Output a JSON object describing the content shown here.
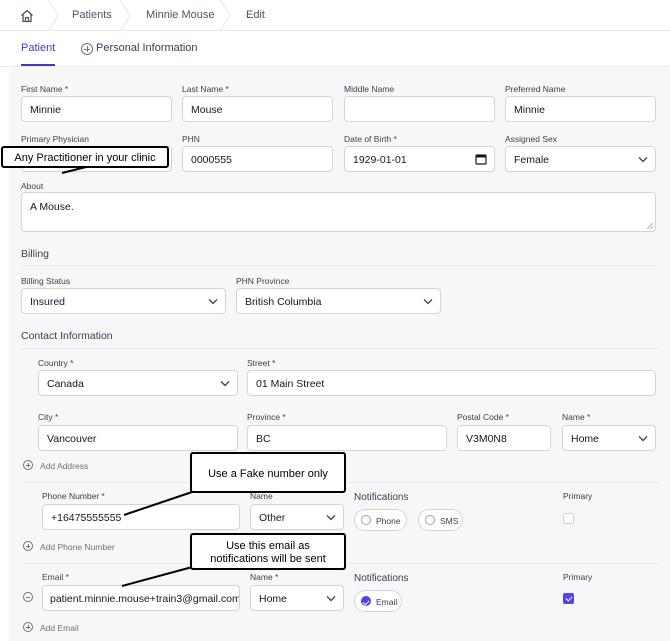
{
  "breadcrumb": {
    "items": [
      "Patients",
      "Minnie Mouse",
      "Edit"
    ],
    "home_icon": "home-icon"
  },
  "tabs": {
    "active": "Patient",
    "other": "Personal Information"
  },
  "patient": {
    "first_name_label": "First Name *",
    "first_name": "Minnie",
    "last_name_label": "Last Name *",
    "last_name": "Mouse",
    "middle_name_label": "Middle Name",
    "middle_name": "",
    "preferred_name_label": "Preferred Name",
    "preferred_name": "Minnie",
    "physician_label": "Primary Physician",
    "phn_label": "PHN",
    "phn": "0000555",
    "dob_label": "Date of Birth *",
    "dob": "1929-01-01",
    "sex_label": "Assigned Sex",
    "sex": "Female",
    "about_label": "About",
    "about": "A Mouse."
  },
  "billing": {
    "title": "Billing",
    "status_label": "Billing Status",
    "status": "Insured",
    "province_label": "PHN Province",
    "province": "British Columbia"
  },
  "contact": {
    "title": "Contact Information",
    "country_label": "Country *",
    "country": "Canada",
    "street_label": "Street *",
    "street": "01 Main Street",
    "city_label": "City *",
    "city": "Vancouver",
    "province_label": "Province *",
    "province": "BC",
    "postal_label": "Postal Code *",
    "postal": "V3M0N8",
    "addr_name_label": "Name *",
    "addr_name": "Home",
    "add_address": "Add Address"
  },
  "phone": {
    "number_label": "Phone Number *",
    "number": "+16475555555",
    "name_label": "Name",
    "name": "Other",
    "notifications_label": "Notifications",
    "opt_phone": "Phone",
    "opt_sms": "SMS",
    "primary_label": "Primary",
    "add_phone": "Add Phone Number"
  },
  "email": {
    "label": "Email *",
    "value": "patient.minnie.mouse+train3@gmail.com",
    "name_label": "Name *",
    "name": "Home",
    "notifications_label": "Notifications",
    "opt_email": "Email",
    "primary_label": "Primary",
    "add_email": "Add Email"
  },
  "callouts": {
    "physician": "Any Practitioner in your clinic",
    "phone": "Use a Fake number only",
    "email_line1": "Use this email as",
    "email_line2": "notifications will be sent"
  },
  "colors": {
    "accent": "#4338ca",
    "checkbox": "#4f46e5",
    "panel_bg": "#f7f7f8"
  }
}
